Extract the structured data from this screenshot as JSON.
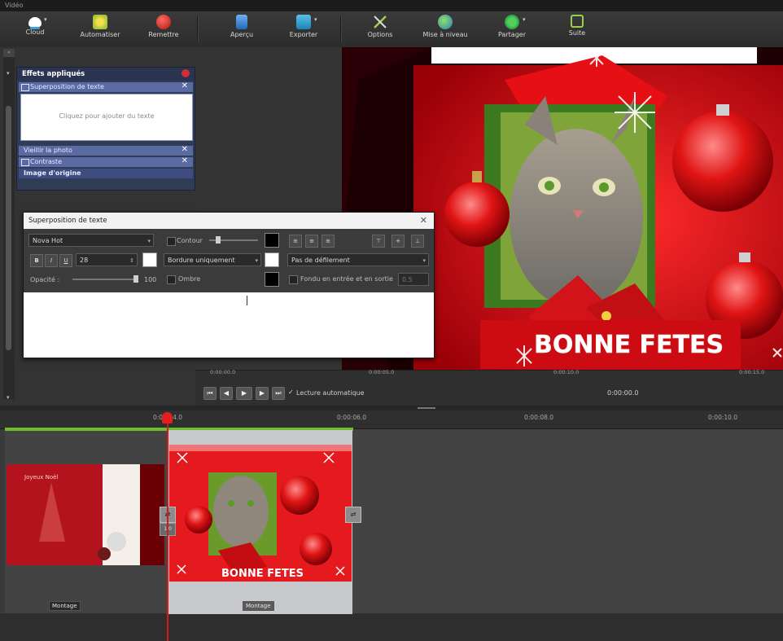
{
  "window": {
    "title": "Vidéo"
  },
  "toolbar": {
    "items": [
      {
        "label": "Cloud",
        "icon": "cloud-icon"
      },
      {
        "label": "Automatiser",
        "icon": "magic-wand-icon"
      },
      {
        "label": "Remettre",
        "icon": "reset-icon"
      },
      {
        "label": "Aperçu",
        "icon": "preview-icon"
      },
      {
        "label": "Exporter",
        "icon": "export-icon"
      },
      {
        "label": "Options",
        "icon": "options-icon"
      },
      {
        "label": "Mise à niveau",
        "icon": "upgrade-icon"
      },
      {
        "label": "Partager",
        "icon": "share-icon"
      },
      {
        "label": "Suite",
        "icon": "suite-icon"
      }
    ]
  },
  "effects": {
    "title": "Effets appliqués",
    "items": [
      {
        "label": "Superposition de texte"
      },
      {
        "label": "Ajouter du texte"
      },
      {
        "label": "Vieillir la photo"
      },
      {
        "label": "Contraste"
      },
      {
        "label": "Image d'origine"
      }
    ],
    "body_hint": "Cliquez pour ajouter du texte"
  },
  "dialog": {
    "title": "Superposition de texte",
    "font_name": "Nova Hot",
    "font_size": "28",
    "contour_label": "Contour",
    "opacity_label": "Opacité :",
    "opacity_value": "100",
    "ombre_label": "Ombre",
    "fill_mode": "Bordure uniquement",
    "scroll_mode": "Pas de défilement",
    "fade_label": "Fondu en entrée et en sortie",
    "fade_value": "0.5",
    "bold": "B",
    "italic": "I",
    "underline": "U"
  },
  "preview": {
    "caption": "BONNE FETES",
    "timecodes": [
      "0:00:00.0",
      "0:00:05.0",
      "0:00:10.0",
      "0:00:15.0"
    ]
  },
  "player": {
    "autoplay_label": "Lecture automatique",
    "time": "0:00:00.0"
  },
  "timeline": {
    "ruler": [
      "0:00:04.0",
      "0:00:06.0",
      "0:00:08.0",
      "0:00:10.0"
    ],
    "clips": [
      {
        "caption": "Montage"
      },
      {
        "caption": "BONNE FETES",
        "label": "Montage"
      }
    ],
    "transitions": [
      "⇄",
      "⇄"
    ],
    "transition_duration": "1.0"
  },
  "colors": {
    "accent_red": "#d81a1a",
    "timeline_green": "#6cbf2c",
    "panel_blue": "#5a6aa3"
  }
}
